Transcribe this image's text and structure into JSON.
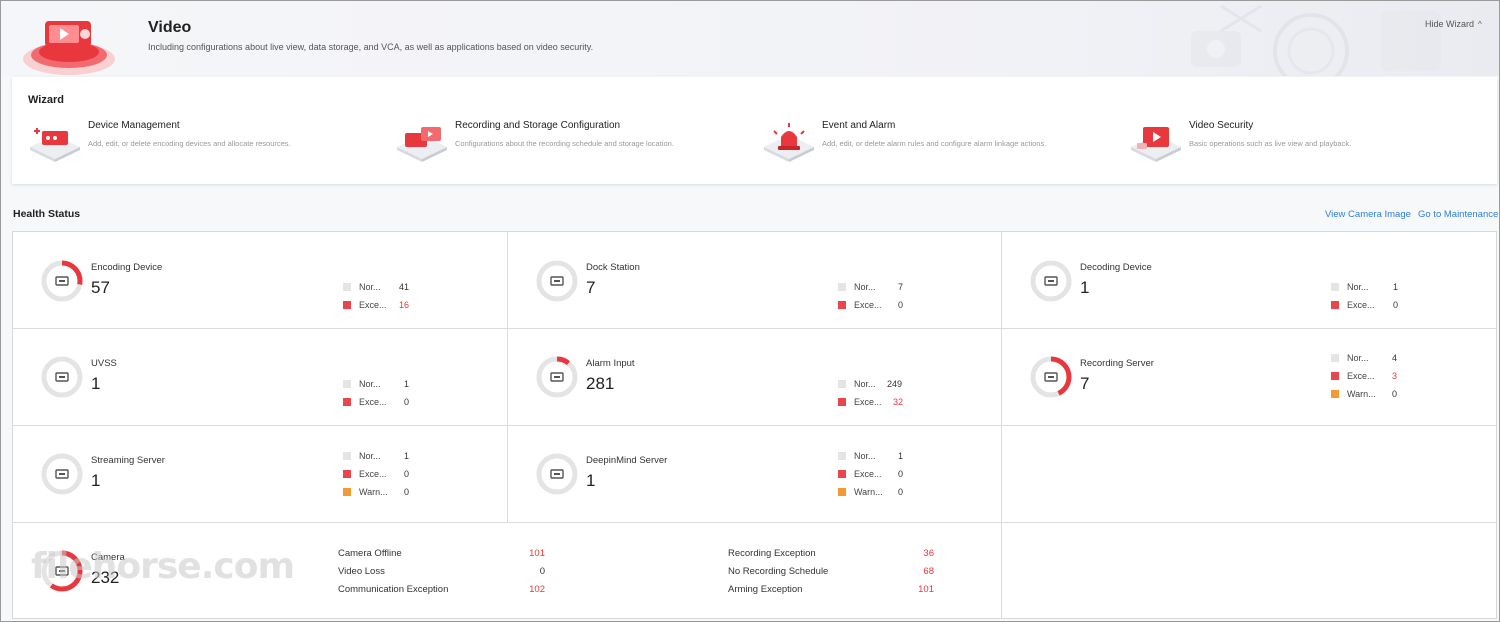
{
  "header": {
    "title": "Video",
    "subtitle": "Including configurations about live view, data storage, and VCA, as well as applications based on video security.",
    "hide_wizard": "Hide Wizard"
  },
  "wizard": {
    "title": "Wizard",
    "items": [
      {
        "name": "Device Management",
        "desc": "Add, edit, or delete encoding devices and allocate resources."
      },
      {
        "name": "Recording and Storage Configuration",
        "desc": "Configurations about the recording schedule and storage location."
      },
      {
        "name": "Event and Alarm",
        "desc": "Add, edit, or delete alarm rules and configure alarm linkage actions."
      },
      {
        "name": "Video Security",
        "desc": "Basic operations such as live view and playback."
      }
    ]
  },
  "health": {
    "title": "Health Status",
    "view_camera_image": "View Camera Image",
    "go_to_maintenance": "Go to Maintenance",
    "labels": {
      "normal": "Nor...",
      "exception": "Exce...",
      "warning": "Warn..."
    },
    "cells": [
      {
        "name": "Encoding Device",
        "count": "57",
        "normal": "41",
        "exception": "16",
        "exception_fraction": 0.28,
        "ring_icon": "encoder-icon"
      },
      {
        "name": "Dock Station",
        "count": "7",
        "normal": "7",
        "exception": "0",
        "exception_fraction": 0,
        "ring_icon": "dock-station-icon"
      },
      {
        "name": "Decoding Device",
        "count": "1",
        "normal": "1",
        "exception": "0",
        "exception_fraction": 0,
        "ring_icon": "decoder-icon"
      },
      {
        "name": "UVSS",
        "count": "1",
        "normal": "1",
        "exception": "0",
        "exception_fraction": 0,
        "ring_icon": "uvss-icon"
      },
      {
        "name": "Alarm Input",
        "count": "281",
        "normal": "249",
        "exception": "32",
        "exception_fraction": 0.11,
        "ring_icon": "alarm-input-icon"
      },
      {
        "name": "Recording Server",
        "count": "7",
        "normal": "4",
        "exception": "3",
        "warning": "0",
        "exception_fraction": 0.43,
        "ring_icon": "recording-server-icon"
      },
      {
        "name": "Streaming Server",
        "count": "1",
        "normal": "1",
        "exception": "0",
        "warning": "0",
        "exception_fraction": 0,
        "ring_icon": "streaming-server-icon"
      },
      {
        "name": "DeepinMind Server",
        "count": "1",
        "normal": "1",
        "exception": "0",
        "warning": "0",
        "exception_fraction": 0,
        "ring_icon": "deepinmind-server-icon"
      }
    ],
    "camera": {
      "name": "Camera",
      "count": "232",
      "exception_fraction": 0.6,
      "stats_left": [
        {
          "label": "Camera Offline",
          "value": "101"
        },
        {
          "label": "Video Loss",
          "value": "0"
        },
        {
          "label": "Communication Exception",
          "value": "102"
        }
      ],
      "stats_right": [
        {
          "label": "Recording Exception",
          "value": "36"
        },
        {
          "label": "No Recording Schedule",
          "value": "68"
        },
        {
          "label": "Arming Exception",
          "value": "101"
        }
      ]
    }
  },
  "colors": {
    "accent": "#e8383d",
    "link": "#2f7fd6",
    "ring_bg": "#e4e4e4",
    "warning": "#f39a33"
  },
  "watermark": "filehorse.com"
}
